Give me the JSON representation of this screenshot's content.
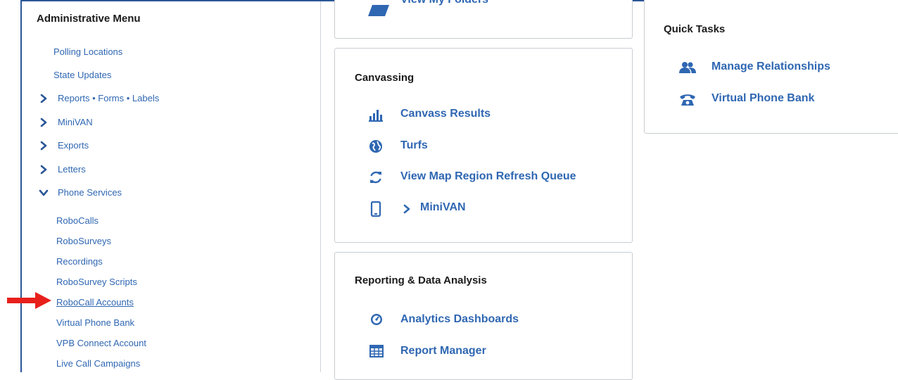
{
  "admin_menu": {
    "title": "Administrative Menu",
    "items": [
      {
        "label": "Polling Locations"
      },
      {
        "label": "State Updates"
      },
      {
        "label": "Reports • Forms • Labels"
      },
      {
        "label": "MiniVAN"
      },
      {
        "label": "Exports"
      },
      {
        "label": "Letters"
      },
      {
        "label": "Phone Services"
      }
    ],
    "phone_services_items": [
      {
        "label": "RoboCalls"
      },
      {
        "label": "RoboSurveys"
      },
      {
        "label": "Recordings"
      },
      {
        "label": "RoboSurvey Scripts"
      },
      {
        "label": "RoboCall Accounts"
      },
      {
        "label": "Virtual Phone Bank"
      },
      {
        "label": "VPB Connect Account"
      },
      {
        "label": "Live Call Campaigns"
      }
    ]
  },
  "folders_card": {
    "link": "View My Folders"
  },
  "canvassing_card": {
    "title": "Canvassing",
    "links": [
      {
        "label": "Canvass Results",
        "icon": "bar-chart-icon"
      },
      {
        "label": "Turfs",
        "icon": "globe-icon"
      },
      {
        "label": "View Map Region Refresh Queue",
        "icon": "refresh-icon"
      },
      {
        "label": "MiniVAN",
        "icon": "mobile-phone-icon"
      }
    ]
  },
  "reporting_card": {
    "title": "Reporting & Data Analysis",
    "links": [
      {
        "label": "Analytics Dashboards",
        "icon": "dashboard-gauge-icon"
      },
      {
        "label": "Report Manager",
        "icon": "table-icon"
      }
    ]
  },
  "quick_tasks_card": {
    "title": "Quick Tasks",
    "links": [
      {
        "label": "Manage Relationships",
        "icon": "users-icon"
      },
      {
        "label": "Virtual Phone Bank",
        "icon": "telephone-icon"
      }
    ]
  },
  "colors": {
    "link": "#2f67b2",
    "accent_frame": "#2b5797",
    "highlight_arrow": "#e8201c",
    "card_border": "#c9cdd2"
  }
}
